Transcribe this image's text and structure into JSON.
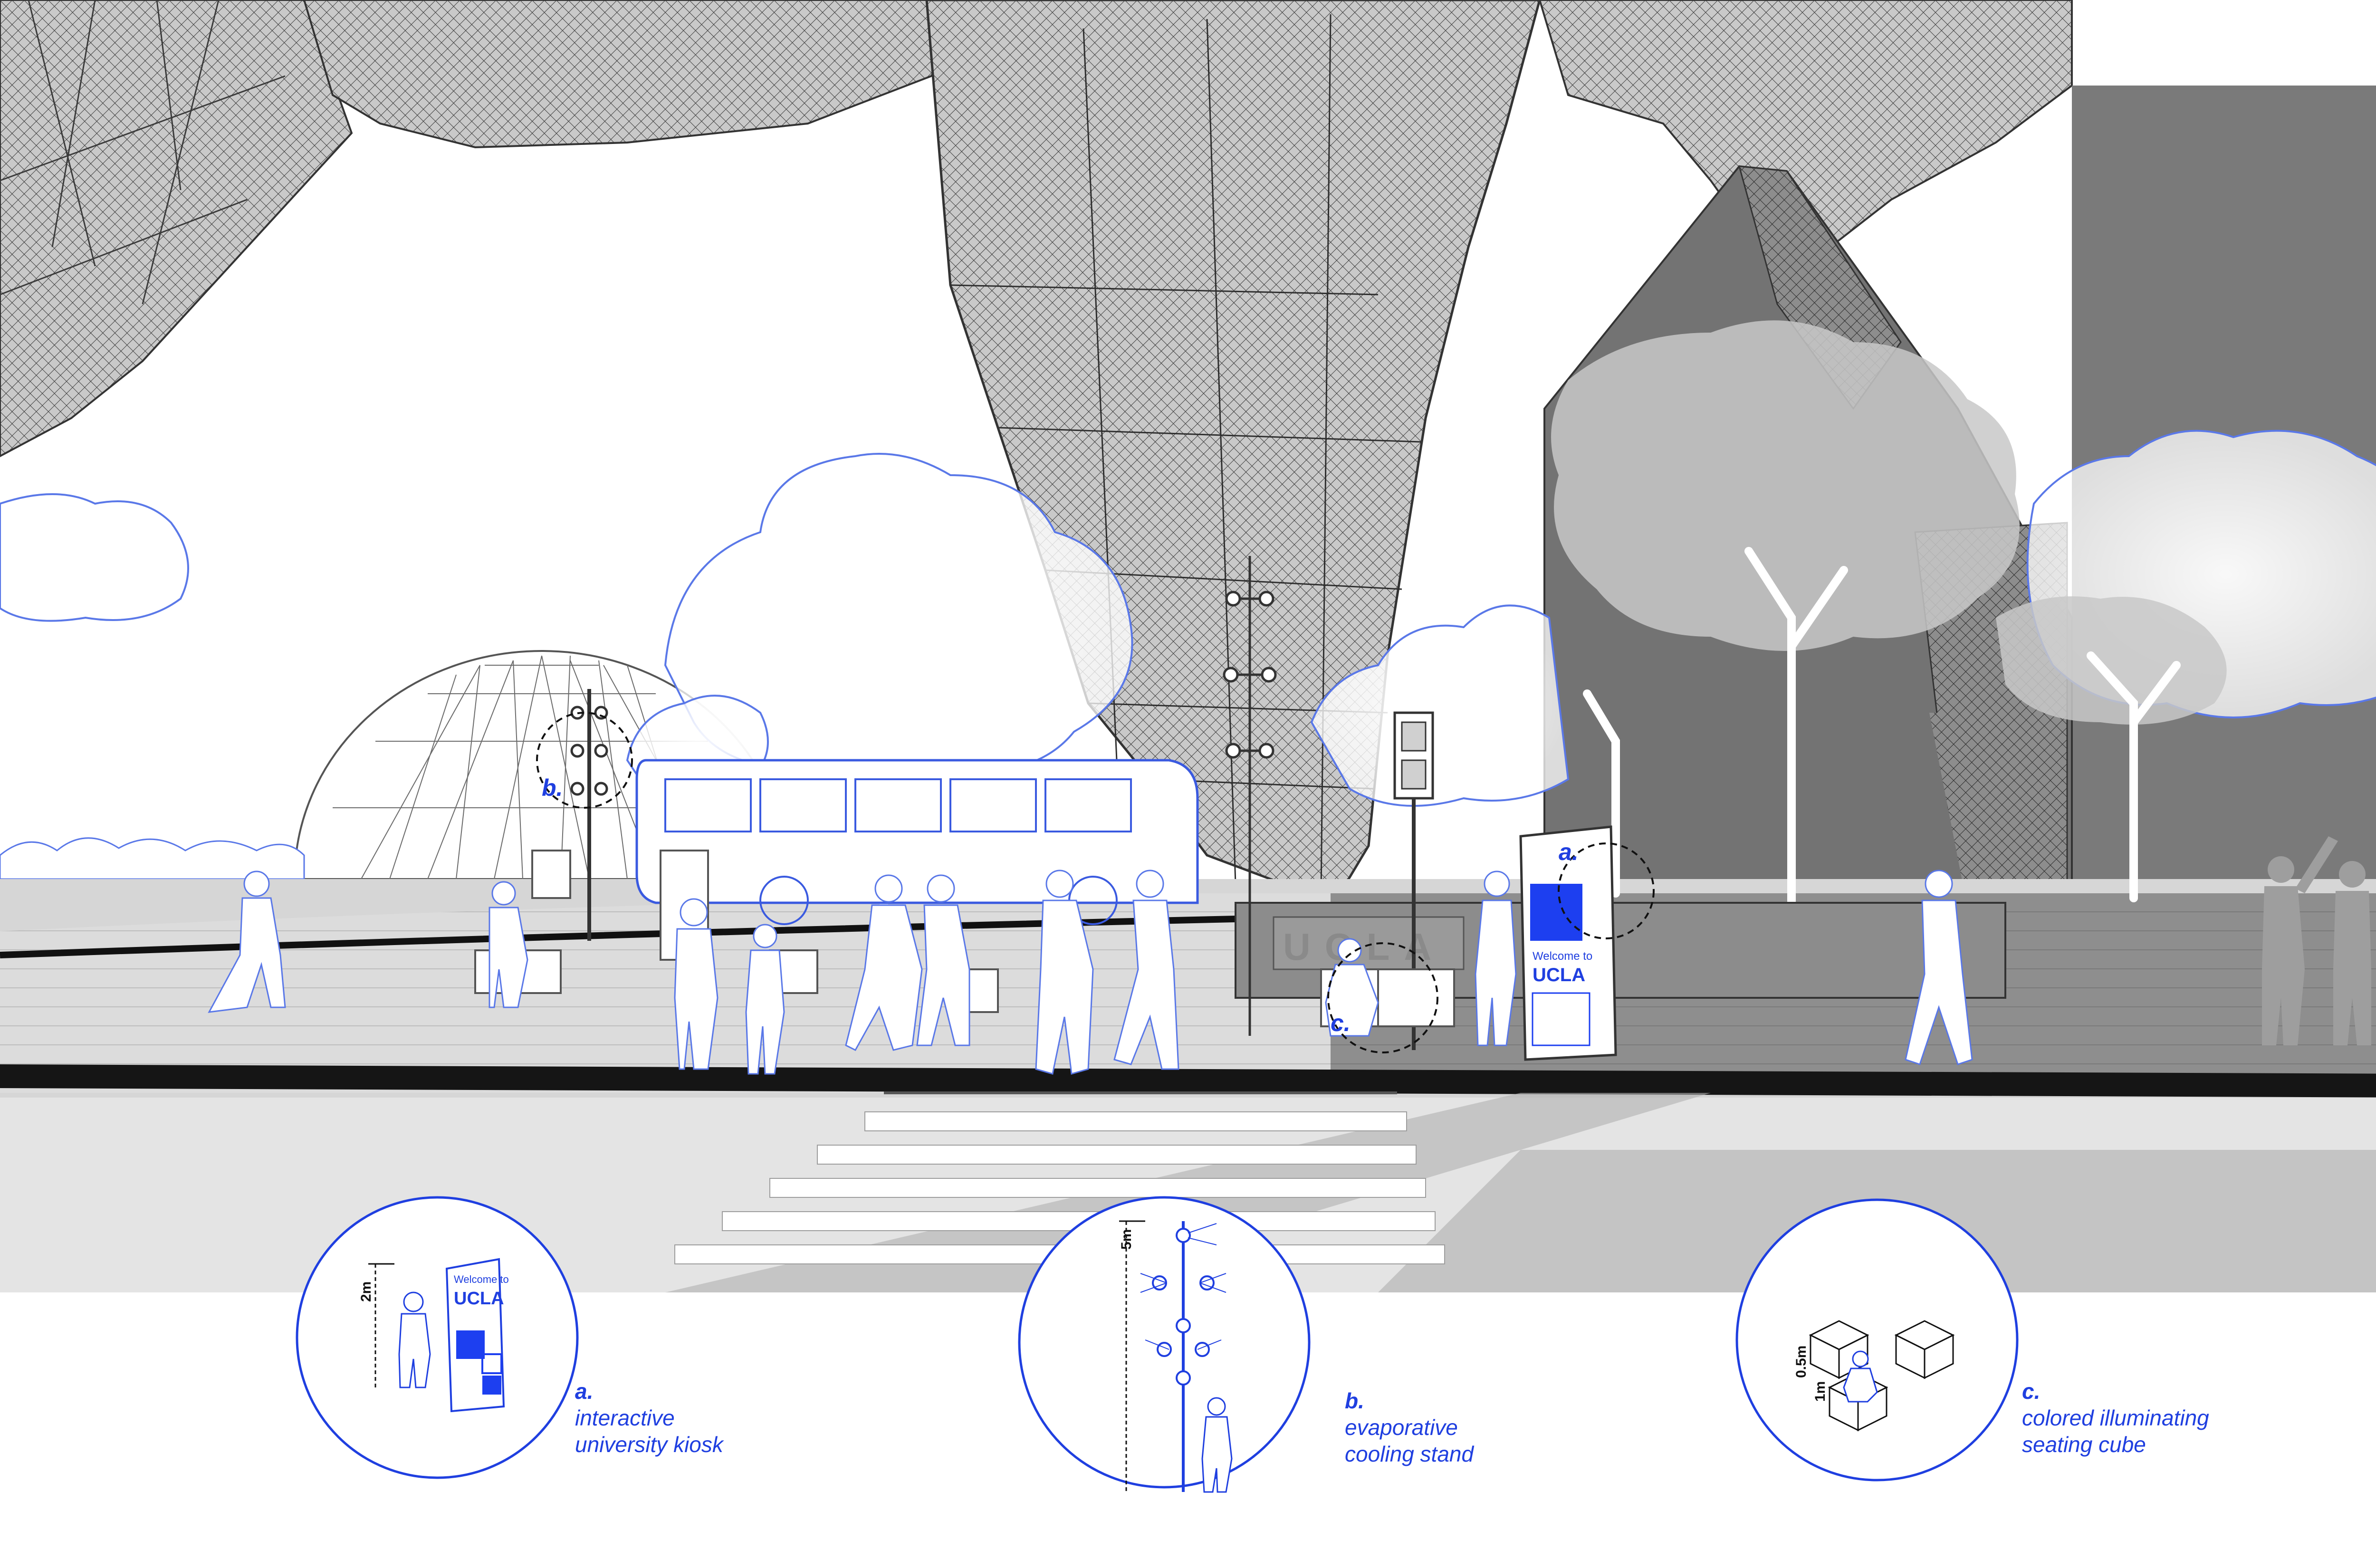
{
  "colors": {
    "accent_blue": "#1f3fe0",
    "kiosk_blue": "#1d3ff0",
    "building_grey": "#6f6f6f",
    "mesh_grey": "#9a9a9a",
    "ground_grey": "#cfcfcf",
    "tree_outline": "#5a78e8",
    "white": "#ffffff"
  },
  "scene": {
    "marker_a": "a.",
    "marker_b": "b.",
    "marker_c": "c.",
    "kiosk_welcome": "Welcome to",
    "kiosk_ucla": "UCLA",
    "building_sign": "UCLA"
  },
  "insets": [
    {
      "id": "kiosk",
      "dimension": "2m",
      "screen_welcome": "Welcome to",
      "screen_ucla": "UCLA",
      "caption_letter": "a.",
      "caption_lines": [
        "interactive",
        "university kiosk"
      ]
    },
    {
      "id": "cooling-stand",
      "dimension": "5m",
      "caption_letter": "b.",
      "caption_lines": [
        "evaporative",
        "cooling stand"
      ]
    },
    {
      "id": "seating-cube",
      "dimension_height": "0.5m",
      "dimension_width": "1m",
      "caption_letter": "c.",
      "caption_lines": [
        "colored illuminating",
        "seating cube"
      ]
    }
  ],
  "icons": [
    "pedestrian-signal-icon",
    "person-silhouette-icon",
    "tree-icon",
    "geodesic-dome-icon",
    "bus-icon"
  ]
}
